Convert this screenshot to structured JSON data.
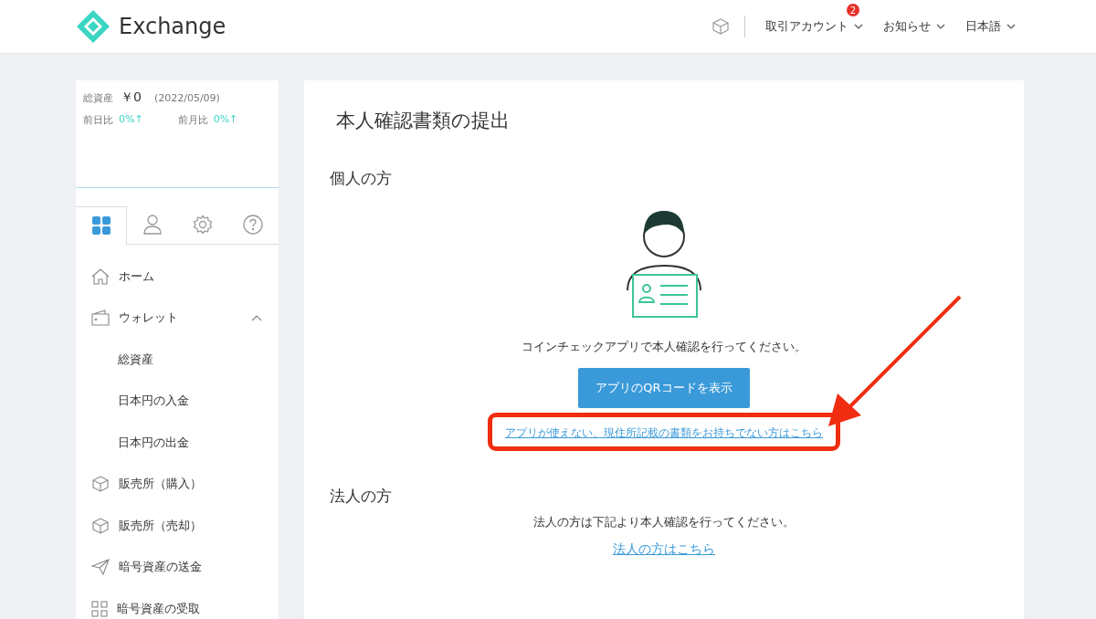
{
  "header": {
    "logo_text": "Exchange",
    "menus": [
      {
        "label": "取引アカウント",
        "badge": "2"
      },
      {
        "label": "お知らせ"
      },
      {
        "label": "日本語"
      }
    ]
  },
  "summary": {
    "total_label": "総資産",
    "total_value": "￥0",
    "date": "(2022/05/09)",
    "changes": [
      {
        "label": "前日比",
        "value": "0%↑"
      },
      {
        "label": "前月比",
        "value": "0%↑"
      }
    ]
  },
  "sidebar": {
    "tabs": [
      {
        "selected": true
      },
      {
        "selected": false
      },
      {
        "selected": false
      },
      {
        "selected": false
      }
    ],
    "items": [
      {
        "label": "ホーム"
      },
      {
        "label": "ウォレット",
        "expanded": true,
        "children": [
          {
            "label": "総資産"
          },
          {
            "label": "日本円の入金"
          },
          {
            "label": "日本円の出金"
          }
        ]
      },
      {
        "label": "販売所（購入）"
      },
      {
        "label": "販売所（売却）"
      },
      {
        "label": "暗号資産の送金"
      },
      {
        "label": "暗号資産の受取"
      }
    ]
  },
  "main": {
    "title": "本人確認書類の提出",
    "personal": {
      "heading": "個人の方",
      "instruction": "コインチェックアプリで本人確認を行ってください。",
      "button": "アプリのQRコードを表示",
      "alt_link": "アプリが使えない、現住所記載の書類をお持ちでない方はこちら"
    },
    "corporate": {
      "heading": "法人の方",
      "instruction": "法人の方は下記より本人確認を行ってください。",
      "link": "法人の方はこちら"
    }
  }
}
